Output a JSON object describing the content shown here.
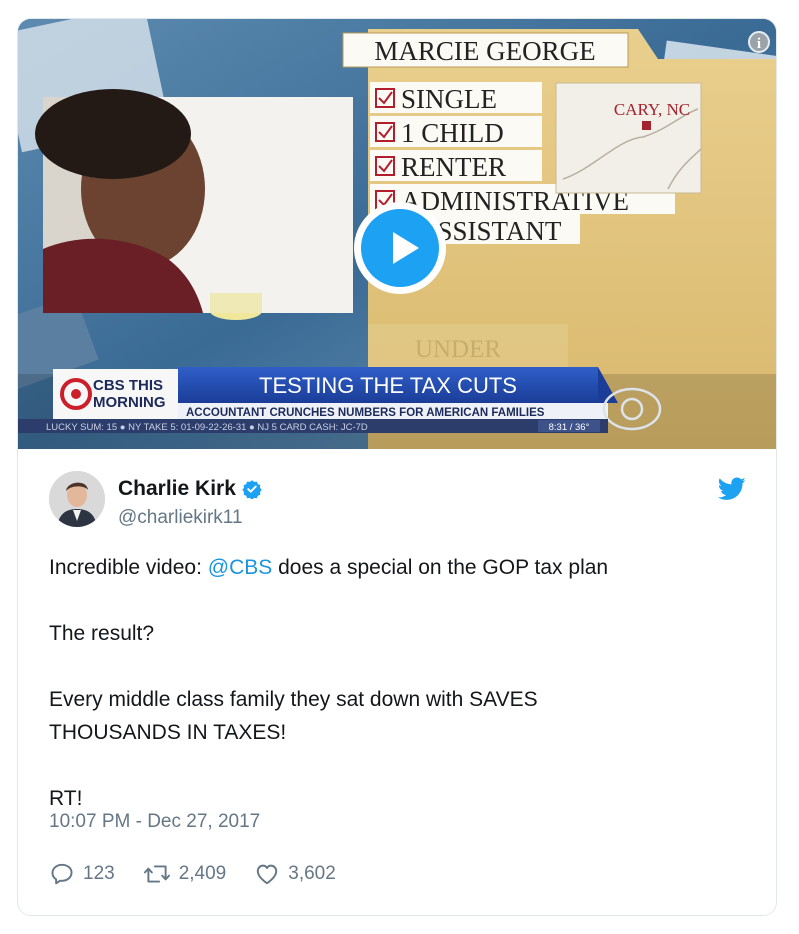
{
  "video": {
    "lower_third_title": "TESTING THE TAX CUTS",
    "lower_third_subtitle": "ACCOUNTANT CRUNCHES NUMBERS FOR AMERICAN FAMILIES",
    "network_logo_line1": "CBS THIS",
    "network_logo_line2": "MORNING",
    "ticker_text": "LUCKY SUM: 15  ●  NY TAKE 5: 01-09-22-26-31  ●  NJ 5 CARD CASH: JC-7D",
    "clock": "8:31 / 36°",
    "folder_name": "MARCIE GEORGE",
    "checklist": [
      "SINGLE",
      "1 CHILD",
      "RENTER",
      "ADMINISTRATIVE",
      "ASSISTANT"
    ],
    "map_label": "CARY, NC",
    "under_label": "UNDER"
  },
  "author": {
    "name": "Charlie Kirk",
    "handle": "@charliekirk11"
  },
  "tweet": {
    "line1_prefix": "Incredible video: ",
    "mention": "@CBS",
    "line1_suffix": " does a special on the GOP tax plan",
    "line2": "The result?",
    "line3": "Every middle class family they sat down with SAVES",
    "line4": "THOUSANDS IN TAXES!",
    "line5": "RT!",
    "timestamp": "10:07 PM - Dec 27, 2017"
  },
  "stats": {
    "replies": "123",
    "retweets": "2,409",
    "likes": "3,602"
  },
  "colors": {
    "link": "#1b95e0",
    "twitter_blue": "#1da1f2",
    "muted": "#657786"
  }
}
